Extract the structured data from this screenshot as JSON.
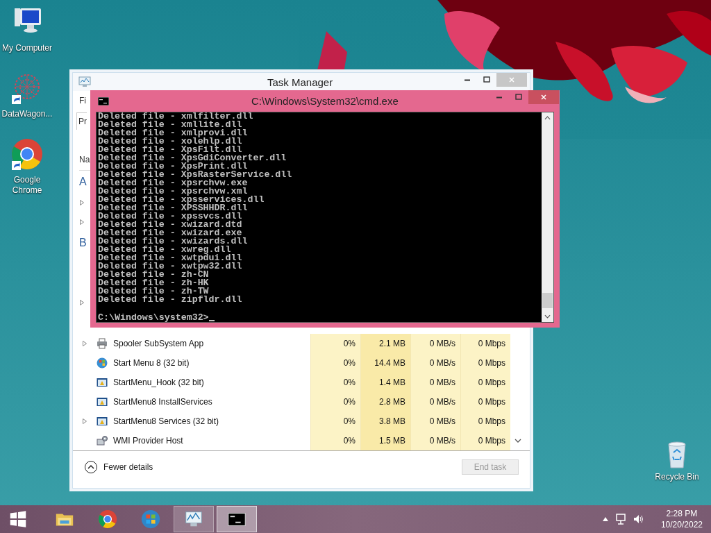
{
  "desktop": {
    "icons": [
      {
        "kind": "computer",
        "label": "My Computer",
        "shortcut": false
      },
      {
        "kind": "network",
        "label": "DataWagon...",
        "shortcut": true
      },
      {
        "kind": "chrome",
        "label": "Google Chrome",
        "shortcut": true
      }
    ],
    "recycle_bin": {
      "label": "Recycle Bin"
    }
  },
  "task_manager": {
    "title": "Task Manager",
    "fragments": [
      {
        "kind": "menu",
        "text": "Fi"
      },
      {
        "kind": "tab",
        "text": "Pr"
      },
      {
        "kind": "header",
        "text": "Na"
      },
      {
        "kind": "group",
        "text": "A"
      },
      {
        "kind": "row",
        "expanded": false
      },
      {
        "kind": "row",
        "expanded": false
      },
      {
        "kind": "group",
        "text": "B"
      },
      {
        "kind": "row",
        "expanded": false
      }
    ],
    "rows": [
      {
        "name": "Spooler SubSystem App",
        "kind": "printer",
        "expanded": false,
        "cpu": "0%",
        "memory": "2.1 MB",
        "disk": "0 MB/s",
        "network": "0 Mbps"
      },
      {
        "name": "Start Menu 8 (32 bit)",
        "kind": "orb",
        "cpu": "0%",
        "memory": "14.4 MB",
        "disk": "0 MB/s",
        "network": "0 Mbps"
      },
      {
        "name": "StartMenu_Hook (32 bit)",
        "kind": "app",
        "cpu": "0%",
        "memory": "1.4 MB",
        "disk": "0 MB/s",
        "network": "0 Mbps"
      },
      {
        "name": "StartMenu8 InstallServices",
        "kind": "app",
        "cpu": "0%",
        "memory": "2.8 MB",
        "disk": "0 MB/s",
        "network": "0 Mbps"
      },
      {
        "name": "StartMenu8 Services (32 bit)",
        "kind": "app",
        "expanded": false,
        "cpu": "0%",
        "memory": "3.8 MB",
        "disk": "0 MB/s",
        "network": "0 Mbps"
      },
      {
        "name": "WMI Provider Host",
        "kind": "wmi",
        "cpu": "0%",
        "memory": "1.5 MB",
        "disk": "0 MB/s",
        "network": "0 Mbps"
      }
    ],
    "details_toggle": "Fewer details",
    "end_task": {
      "label": "End task",
      "disabled": true
    }
  },
  "cmd": {
    "title": "C:\\Windows\\System32\\cmd.exe",
    "lines": [
      "Deleted file - xmlfilter.dll",
      "Deleted file - xmllite.dll",
      "Deleted file - xmlprovi.dll",
      "Deleted file - xolehlp.dll",
      "Deleted file - XpsFilt.dll",
      "Deleted file - XpsGdiConverter.dll",
      "Deleted file - XpsPrint.dll",
      "Deleted file - XpsRasterService.dll",
      "Deleted file - xpsrchvw.exe",
      "Deleted file - xpsrchvw.xml",
      "Deleted file - xpsservices.dll",
      "Deleted file - XPSSHHDR.dll",
      "Deleted file - xpssvcs.dll",
      "Deleted file - xwizard.dtd",
      "Deleted file - xwizard.exe",
      "Deleted file - xwizards.dll",
      "Deleted file - xwreg.dll",
      "Deleted file - xwtpdui.dll",
      "Deleted file - xwtpw32.dll",
      "Deleted file - zh-CN",
      "Deleted file - zh-HK",
      "Deleted file - zh-TW",
      "Deleted file - zipfldr.dll"
    ],
    "prompt": "C:\\Windows\\system32>"
  },
  "taskbar": {
    "items": [
      {
        "kind": "start",
        "open": false,
        "selected": false
      },
      {
        "kind": "explorer",
        "open": false,
        "selected": false
      },
      {
        "kind": "chrome",
        "open": false,
        "selected": false
      },
      {
        "kind": "orb",
        "open": false,
        "selected": false
      },
      {
        "kind": "taskmgr",
        "open": true,
        "selected": false
      },
      {
        "kind": "cmd",
        "open": true,
        "selected": true
      }
    ],
    "time": "2:28 PM",
    "date": "10/20/2022"
  }
}
